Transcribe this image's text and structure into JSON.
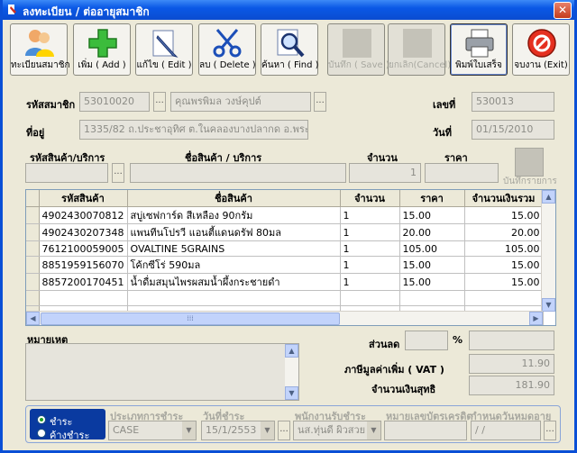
{
  "window": {
    "title": "ลงทะเบียน / ต่ออายุสมาชิก",
    "close": "✕"
  },
  "toolbar": [
    {
      "id": "register",
      "label": "ทะเบียนสมาชิก",
      "icon": "users-icon",
      "enabled": true
    },
    {
      "id": "add",
      "label": "เพิ่ม ( Add )",
      "icon": "plus-icon",
      "enabled": true
    },
    {
      "id": "edit",
      "label": "แก้ไข ( Edit )",
      "icon": "pencil-icon",
      "enabled": true
    },
    {
      "id": "delete",
      "label": "ลบ ( Delete )",
      "icon": "scissors-icon",
      "enabled": true
    },
    {
      "id": "find",
      "label": "ค้นหา ( Find )",
      "icon": "magnifier-icon",
      "enabled": true
    },
    {
      "id": "save",
      "label": "บันทึก ( Save )",
      "icon": "save-icon",
      "enabled": false
    },
    {
      "id": "cancel",
      "label": "ยกเลิก(Cancel)",
      "icon": "cancel-icon",
      "enabled": false
    },
    {
      "id": "print",
      "label": "พิมพ์ใบเสร็จ",
      "icon": "printer-icon",
      "enabled": true
    },
    {
      "id": "exit",
      "label": "จบงาน (Exit)",
      "icon": "exit-icon",
      "enabled": true
    }
  ],
  "member": {
    "code_label": "รหัสสมาชิก",
    "code": "53010020",
    "name": "คุณพรพิมล วงษ์คุปต์",
    "doc_no_label": "เลขที่",
    "doc_no": "530013",
    "address_label": "ที่อยู่",
    "address": "1335/82 ถ.ประชาอุทิศ ต.ในคลองบางปลากด อ.พระสมุทรเจดีย์",
    "date_label": "วันที่",
    "date": "01/15/2010"
  },
  "entry": {
    "code_label": "รหัสสินค้า/บริการ",
    "name_label": "ชื่อสินค้า / บริการ",
    "qty_label": "จำนวน",
    "qty": "1",
    "price_label": "ราคา",
    "save_item_label": "บันทึกรายการ",
    "dots": "..."
  },
  "grid": {
    "headers": [
      "รหัสสินค้า",
      "ชื่อสินค้า",
      "จำนวน",
      "ราคา",
      "จำนวนเงินรวม"
    ],
    "rows": [
      [
        "4902430070812",
        "สบู่เซฟการ์ด สีเหลือง 90กรัม",
        "1",
        "15.00",
        "15.00"
      ],
      [
        "4902430207348",
        "แพนทีนโปรวี แอนตี้แดนดรัฟ 80มล",
        "1",
        "20.00",
        "20.00"
      ],
      [
        "7612100059005",
        "OVALTINE 5GRAINS",
        "1",
        "105.00",
        "105.00"
      ],
      [
        "8851959156070",
        "โค้กซีโร่ 590มล",
        "1",
        "15.00",
        "15.00"
      ],
      [
        "8857200170451",
        "น้ำดื่มสมุนไพรผสมน้ำผึ้งกระชายดำ",
        "1",
        "15.00",
        "15.00"
      ]
    ],
    "empty_rows": 4,
    "scroll": {
      "left": "◀",
      "right": "▶",
      "up": "▲",
      "down": "▼",
      "grip": "⁞⁞⁞"
    }
  },
  "summary": {
    "note_label": "หมายเหตุ",
    "discount_label": "ส่วนลด",
    "percent": "%",
    "vat_label": "ภาษีมูลค่าเพิ่ม ( VAT )",
    "vat": "11.90",
    "net_label": "จำนวนเงินสุทธิ",
    "net": "181.90"
  },
  "payment": {
    "paid": "ชำระ",
    "unpaid": "ค้างชำระ",
    "type_label": "ประเภทการชำระ",
    "type": "CASE",
    "pay_date_label": "วันที่ชำระ",
    "pay_date": "15/1/2553",
    "staff_label": "พนักงานรับชำระ",
    "staff": "นส.ทุ่นดี ผิวสวย",
    "card_label": "หมายเลขบัตรเครดิต",
    "expiry_label": "กำหนดวันหมดอายุ",
    "expiry": "/ /"
  },
  "colors": {
    "accent": "#0a4cd0",
    "title_bg": "#0a58e6",
    "form_bg": "#ece9d8"
  }
}
